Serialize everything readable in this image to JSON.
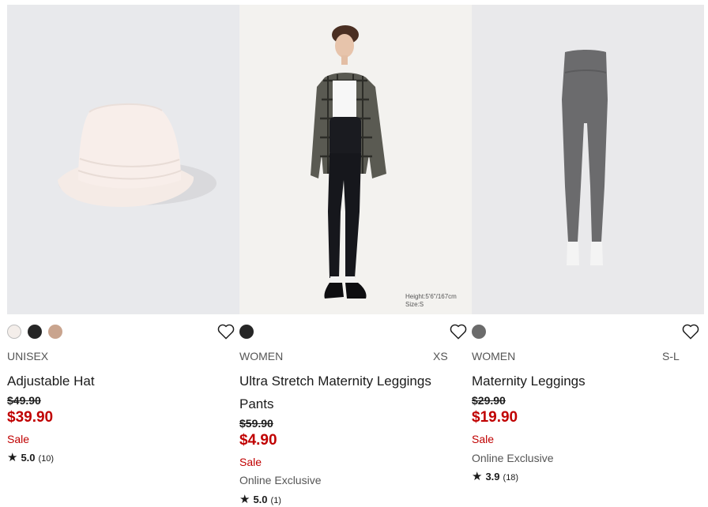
{
  "products": [
    {
      "swatches": [
        "#f4eeea",
        "#262626",
        "#c9a48e"
      ],
      "gender": "UNISEX",
      "size": "",
      "name": "Adjustable Hat",
      "original_price": "$49.90",
      "price": "$39.90",
      "sale": "Sale",
      "exclusive": "",
      "rating": "5.0",
      "reviews": "(10)"
    },
    {
      "swatches": [
        "#262626"
      ],
      "gender": "WOMEN",
      "size": "XS",
      "name": "Ultra Stretch Maternity Leggings Pants",
      "original_price": "$59.90",
      "price": "$4.90",
      "sale": "Sale",
      "exclusive": "Online Exclusive",
      "rating": "5.0",
      "reviews": "(1)",
      "image_caption_1": "Height:5'6\"/167cm",
      "image_caption_2": "Size:S"
    },
    {
      "swatches": [
        "#6b6b6b"
      ],
      "gender": "WOMEN",
      "size": "S-L",
      "name": "Maternity Leggings",
      "original_price": "$29.90",
      "price": "$19.90",
      "sale": "Sale",
      "exclusive": "Online Exclusive",
      "rating": "3.9",
      "reviews": "(18)"
    }
  ],
  "icons": {
    "favorite": "heart-outline-icon",
    "rating": "star-icon"
  },
  "colors": {
    "sale_red": "#c00000",
    "image_bg": "#e9e9eb"
  }
}
